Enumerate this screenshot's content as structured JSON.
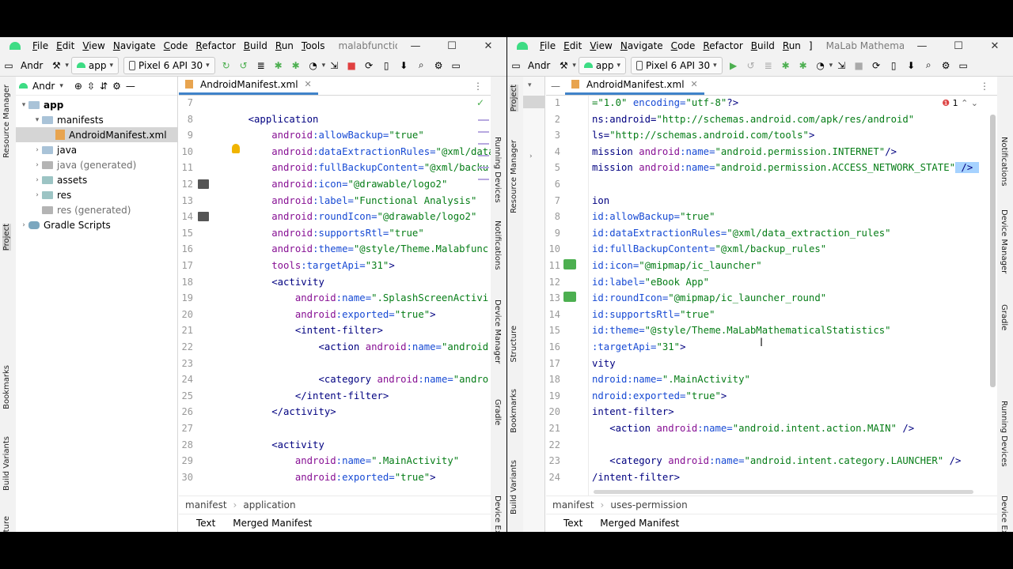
{
  "left": {
    "menu": [
      "File",
      "Edit",
      "View",
      "Navigate",
      "Code",
      "Refactor",
      "Build",
      "Run",
      "Tools"
    ],
    "project_title": "malabfunctionalanaly",
    "toolbar": {
      "project": "Andr",
      "config": "app",
      "device": "Pixel 6 API 30"
    },
    "side_tabs_left": [
      "Resource Manager",
      "Project",
      "Bookmarks",
      "Build Variants",
      "Structure"
    ],
    "side_tabs_right": [
      "Running Devices",
      "Notifications",
      "Device Manager",
      "Gradle",
      "Device Explorer"
    ],
    "panel_header": "Andr",
    "tree": [
      {
        "label": "app",
        "level": 0,
        "icon": "folder",
        "arrow": "down",
        "bold": true
      },
      {
        "label": "manifests",
        "level": 1,
        "icon": "folder",
        "arrow": "down"
      },
      {
        "label": "AndroidManifest.xml",
        "level": 2,
        "icon": "xml",
        "selected": true
      },
      {
        "label": "java",
        "level": 1,
        "icon": "folder",
        "arrow": "right"
      },
      {
        "label": "java (generated)",
        "level": 1,
        "icon": "folder",
        "arrow": "right",
        "muted": true
      },
      {
        "label": "assets",
        "level": 1,
        "icon": "folder",
        "arrow": "right"
      },
      {
        "label": "res",
        "level": 1,
        "icon": "folder",
        "arrow": "right"
      },
      {
        "label": "res (generated)",
        "level": 1,
        "icon": "folder",
        "arrow": "none",
        "muted": true
      },
      {
        "label": "Gradle Scripts",
        "level": 0,
        "icon": "gradle",
        "arrow": "right"
      }
    ],
    "tab": "AndroidManifest.xml",
    "lines": [
      {
        "n": "7",
        "segs": []
      },
      {
        "n": "8",
        "segs": [
          [
            "tag",
            "    <application"
          ]
        ]
      },
      {
        "n": "9",
        "segs": [
          [
            "ns",
            "        android"
          ],
          [
            "attr",
            ":allowBackup="
          ],
          [
            "val",
            "\"true\""
          ]
        ]
      },
      {
        "n": "10",
        "segs": [
          [
            "ns",
            "        android"
          ],
          [
            "attr",
            ":dataExtractionRules="
          ],
          [
            "val",
            "\"@xml/data"
          ]
        ]
      },
      {
        "n": "11",
        "segs": [
          [
            "ns",
            "        android"
          ],
          [
            "attr",
            ":fullBackupContent="
          ],
          [
            "val",
            "\"@xml/backu"
          ]
        ]
      },
      {
        "n": "12",
        "segs": [
          [
            "ns",
            "        android"
          ],
          [
            "attr",
            ":icon="
          ],
          [
            "val",
            "\"@drawable/logo2\""
          ]
        ]
      },
      {
        "n": "13",
        "segs": [
          [
            "ns",
            "        android"
          ],
          [
            "attr",
            ":label="
          ],
          [
            "val",
            "\"Functional Analysis\""
          ]
        ]
      },
      {
        "n": "14",
        "segs": [
          [
            "ns",
            "        android"
          ],
          [
            "attr",
            ":roundIcon="
          ],
          [
            "val",
            "\"@drawable/logo2\""
          ]
        ]
      },
      {
        "n": "15",
        "segs": [
          [
            "ns",
            "        android"
          ],
          [
            "attr",
            ":supportsRtl="
          ],
          [
            "val",
            "\"true\""
          ]
        ]
      },
      {
        "n": "16",
        "segs": [
          [
            "ns",
            "        android"
          ],
          [
            "attr",
            ":theme="
          ],
          [
            "val",
            "\"@style/Theme.Malabfunc"
          ]
        ]
      },
      {
        "n": "17",
        "segs": [
          [
            "ns",
            "        tools"
          ],
          [
            "attr",
            ":targetApi="
          ],
          [
            "val",
            "\"31\""
          ],
          [
            "tag",
            ">"
          ]
        ]
      },
      {
        "n": "18",
        "segs": [
          [
            "tag",
            "        <activity"
          ]
        ]
      },
      {
        "n": "19",
        "segs": [
          [
            "ns",
            "            android"
          ],
          [
            "attr",
            ":name="
          ],
          [
            "val",
            "\".SplashScreenActivi"
          ]
        ]
      },
      {
        "n": "20",
        "segs": [
          [
            "ns",
            "            android"
          ],
          [
            "attr",
            ":exported="
          ],
          [
            "val",
            "\"true\""
          ],
          [
            "tag",
            ">"
          ]
        ]
      },
      {
        "n": "21",
        "segs": [
          [
            "tag",
            "            <intent-filter>"
          ]
        ]
      },
      {
        "n": "22",
        "segs": [
          [
            "tag",
            "                <action "
          ],
          [
            "ns",
            "android"
          ],
          [
            "attr",
            ":name="
          ],
          [
            "val",
            "\"android"
          ]
        ]
      },
      {
        "n": "23",
        "segs": []
      },
      {
        "n": "24",
        "segs": [
          [
            "tag",
            "                <category "
          ],
          [
            "ns",
            "android"
          ],
          [
            "attr",
            ":name="
          ],
          [
            "val",
            "\"andro"
          ]
        ]
      },
      {
        "n": "25",
        "segs": [
          [
            "tag",
            "            </intent-filter>"
          ]
        ]
      },
      {
        "n": "26",
        "segs": [
          [
            "tag",
            "        </activity>"
          ]
        ]
      },
      {
        "n": "27",
        "segs": []
      },
      {
        "n": "28",
        "segs": [
          [
            "tag",
            "        <activity"
          ]
        ]
      },
      {
        "n": "29",
        "segs": [
          [
            "ns",
            "            android"
          ],
          [
            "attr",
            ":name="
          ],
          [
            "val",
            "\".MainActivity\""
          ]
        ]
      },
      {
        "n": "30",
        "segs": [
          [
            "ns",
            "            android"
          ],
          [
            "attr",
            ":exported="
          ],
          [
            "val",
            "\"true\""
          ],
          [
            "tag",
            ">"
          ]
        ]
      }
    ],
    "breadcrumb": [
      "manifest",
      "application"
    ],
    "bottom_tabs": [
      "Text",
      "Merged Manifest"
    ]
  },
  "right": {
    "menu": [
      "File",
      "Edit",
      "View",
      "Navigate",
      "Code",
      "Refactor",
      "Build",
      "Run",
      "]"
    ],
    "project_title": "MaLab Mathematical Statisti",
    "toolbar": {
      "project": "Andr",
      "config": "app",
      "device": "Pixel 6 API 30"
    },
    "side_tabs_left": [
      "Project",
      "Resource Manager",
      "Structure",
      "Bookmarks",
      "Build Variants"
    ],
    "side_tabs_right": [
      "Notifications",
      "Device Manager",
      "Gradle",
      "Running Devices",
      "Device Explorer"
    ],
    "tab": "AndroidManifest.xml",
    "problems": "1",
    "lines": [
      {
        "n": "1",
        "segs": [
          [
            "val",
            "=\"1.0\""
          ],
          [
            "attr",
            " encoding="
          ],
          [
            "val",
            "\"utf-8\""
          ],
          [
            "tag",
            "?>"
          ]
        ]
      },
      {
        "n": "2",
        "segs": [
          [
            "tag",
            "ns:android="
          ],
          [
            "val",
            "\"http://schemas.android.com/apk/res/android\""
          ]
        ]
      },
      {
        "n": "3",
        "segs": [
          [
            "tag",
            "ls="
          ],
          [
            "val",
            "\"http://schemas.android.com/tools\""
          ],
          [
            "tag",
            ">"
          ]
        ]
      },
      {
        "n": "4",
        "segs": [
          [
            "tag",
            "mission "
          ],
          [
            "ns",
            "android"
          ],
          [
            "attr",
            ":name="
          ],
          [
            "val",
            "\"android.permission.INTERNET\""
          ],
          [
            "tag",
            "/>"
          ]
        ]
      },
      {
        "n": "5",
        "segs": [
          [
            "tag",
            "mission "
          ],
          [
            "ns",
            "android"
          ],
          [
            "attr",
            ":name="
          ],
          [
            "val",
            "\"android.permission.ACCESS_NETWORK_STATE\""
          ],
          [
            "tag",
            " /> "
          ]
        ]
      },
      {
        "n": "6",
        "segs": []
      },
      {
        "n": "7",
        "segs": [
          [
            "tag",
            "ion"
          ]
        ]
      },
      {
        "n": "8",
        "segs": [
          [
            "attr",
            "id:allowBackup="
          ],
          [
            "val",
            "\"true\""
          ]
        ]
      },
      {
        "n": "9",
        "segs": [
          [
            "attr",
            "id:dataExtractionRules="
          ],
          [
            "val",
            "\"@xml/data_extraction_rules\""
          ]
        ]
      },
      {
        "n": "10",
        "segs": [
          [
            "attr",
            "id:fullBackupContent="
          ],
          [
            "val",
            "\"@xml/backup_rules\""
          ]
        ]
      },
      {
        "n": "11",
        "segs": [
          [
            "attr",
            "id:icon="
          ],
          [
            "val",
            "\"@mipmap/ic_launcher\""
          ]
        ]
      },
      {
        "n": "12",
        "segs": [
          [
            "attr",
            "id:label="
          ],
          [
            "val",
            "\"eBook App\""
          ]
        ]
      },
      {
        "n": "13",
        "segs": [
          [
            "attr",
            "id:roundIcon="
          ],
          [
            "val",
            "\"@mipmap/ic_launcher_round\""
          ]
        ]
      },
      {
        "n": "14",
        "segs": [
          [
            "attr",
            "id:supportsRtl="
          ],
          [
            "val",
            "\"true\""
          ]
        ]
      },
      {
        "n": "15",
        "segs": [
          [
            "attr",
            "id:theme="
          ],
          [
            "val",
            "\"@style/Theme.MaLabMathematicalStatistics\""
          ]
        ]
      },
      {
        "n": "16",
        "segs": [
          [
            "attr",
            ":targetApi="
          ],
          [
            "val",
            "\"31\""
          ],
          [
            "tag",
            ">"
          ]
        ]
      },
      {
        "n": "17",
        "segs": [
          [
            "tag",
            "vity"
          ]
        ]
      },
      {
        "n": "18",
        "segs": [
          [
            "attr",
            "ndroid:name="
          ],
          [
            "val",
            "\".MainActivity\""
          ]
        ]
      },
      {
        "n": "19",
        "segs": [
          [
            "attr",
            "ndroid:exported="
          ],
          [
            "val",
            "\"true\""
          ],
          [
            "tag",
            ">"
          ]
        ]
      },
      {
        "n": "20",
        "segs": [
          [
            "tag",
            "intent-filter>"
          ]
        ]
      },
      {
        "n": "21",
        "segs": [
          [
            "tag",
            "   <action "
          ],
          [
            "ns",
            "android"
          ],
          [
            "attr",
            ":name="
          ],
          [
            "val",
            "\"android.intent.action.MAIN\""
          ],
          [
            "tag",
            " />"
          ]
        ]
      },
      {
        "n": "22",
        "segs": []
      },
      {
        "n": "23",
        "segs": [
          [
            "tag",
            "   <category "
          ],
          [
            "ns",
            "android"
          ],
          [
            "attr",
            ":name="
          ],
          [
            "val",
            "\"android.intent.category.LAUNCHER\""
          ],
          [
            "tag",
            " />"
          ]
        ]
      },
      {
        "n": "24",
        "segs": [
          [
            "tag",
            "/intent-filter>"
          ]
        ]
      }
    ],
    "breadcrumb": [
      "manifest",
      "uses-permission"
    ],
    "bottom_tabs": [
      "Text",
      "Merged Manifest"
    ]
  },
  "colors": {
    "tag": "#000080",
    "attr": "#174ad4",
    "value": "#067d17",
    "namespace": "#871094",
    "selection": "#d5d5d5",
    "accent": "#4083c9"
  }
}
